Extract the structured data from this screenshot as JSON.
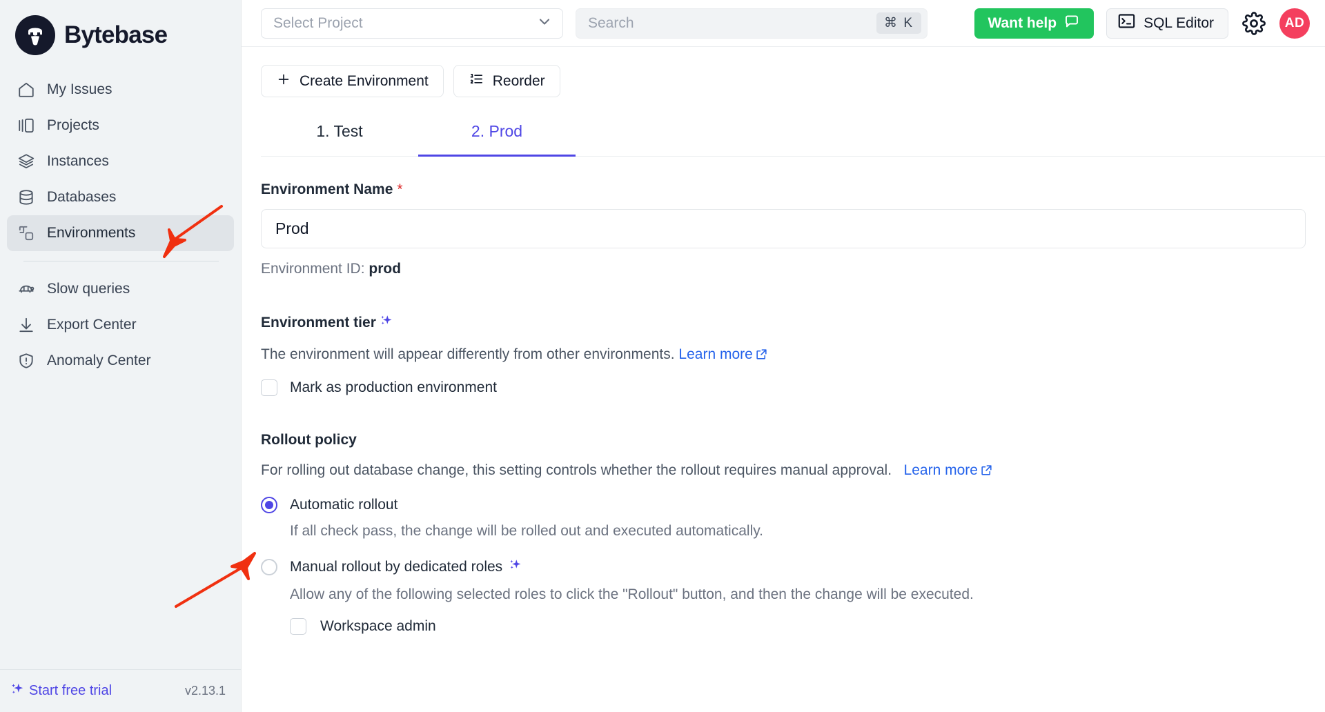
{
  "brand": {
    "name": "Bytebase",
    "logo_icon": "bytebase-logo-icon"
  },
  "sidebar": {
    "items": [
      {
        "label": "My Issues",
        "icon": "home-icon",
        "active": false
      },
      {
        "label": "Projects",
        "icon": "projects-icon",
        "active": false
      },
      {
        "label": "Instances",
        "icon": "layers-icon",
        "active": false
      },
      {
        "label": "Databases",
        "icon": "database-icon",
        "active": false
      },
      {
        "label": "Environments",
        "icon": "environments-icon",
        "active": true
      },
      {
        "label": "Slow queries",
        "icon": "turtle-icon",
        "active": false
      },
      {
        "label": "Export Center",
        "icon": "download-icon",
        "active": false
      },
      {
        "label": "Anomaly Center",
        "icon": "shield-icon",
        "active": false
      }
    ],
    "footer": {
      "trial_label": "Start free trial",
      "trial_icon": "sparkles-icon",
      "version": "v2.13.1",
      "accent_color": "#4f46e5"
    }
  },
  "topbar": {
    "project_select": {
      "placeholder": "Select Project",
      "chevron_icon": "chevron-down-icon"
    },
    "search": {
      "placeholder": "Search",
      "shortcut": "⌘ K"
    },
    "want_help": {
      "label": "Want help",
      "icon": "chat-bubble-icon",
      "color": "#22c55e"
    },
    "sql_editor": {
      "label": "SQL Editor",
      "icon": "terminal-icon"
    },
    "settings_icon": "gear-icon",
    "avatar": {
      "initials": "AD",
      "color": "#f43f5e"
    }
  },
  "toolbar": {
    "create_environment": {
      "label": "Create Environment",
      "icon": "plus-icon"
    },
    "reorder": {
      "label": "Reorder",
      "icon": "list-ordered-icon"
    }
  },
  "tabs": [
    {
      "label": "1. Test",
      "active": false
    },
    {
      "label": "2. Prod",
      "active": true
    }
  ],
  "form": {
    "environment_name": {
      "label": "Environment Name",
      "required_marker": "*",
      "value": "Prod",
      "placeholder": "Environment Name"
    },
    "environment_id_note_prefix": "Environment ID: ",
    "environment_id": "prod",
    "environment_tier": {
      "label": "Environment tier",
      "sparkle_icon": "sparkles-icon",
      "description": "The environment will appear differently from other environments.",
      "learn_more": "Learn more",
      "external_link_icon": "external-link-icon",
      "checkbox": {
        "label": "Mark as production environment",
        "checked": false
      }
    },
    "rollout_policy": {
      "label": "Rollout policy",
      "description": "For rolling out database change, this setting controls whether the rollout requires manual approval.",
      "learn_more": "Learn more",
      "external_link_icon": "external-link-icon",
      "options": [
        {
          "label": "Automatic rollout",
          "selected": true,
          "help": "If all check pass, the change will be rolled out and executed automatically.",
          "sparkle": false
        },
        {
          "label": "Manual rollout by dedicated roles",
          "selected": false,
          "help": "Allow any of the following selected roles to click the \"Rollout\" button, and then the change will be executed.",
          "sparkle": true
        }
      ],
      "roles": [
        {
          "label": "Workspace admin",
          "checked": false
        }
      ]
    }
  },
  "annotations": {
    "arrow_color": "#f03010",
    "arrows": [
      {
        "name": "arrow-to-environments",
        "points_to": "sidebar-item-environments"
      },
      {
        "name": "arrow-to-automatic-rollout",
        "points_to": "radio-automatic-rollout"
      }
    ]
  },
  "theme": {
    "accent": "#4f46e5",
    "link": "#2563eb",
    "green": "#22c55e",
    "sidebar_bg": "#f0f3f5",
    "required_red": "#dc2626"
  }
}
